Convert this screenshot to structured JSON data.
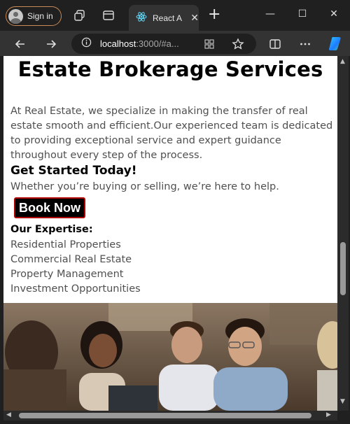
{
  "browser": {
    "signin_label": "Sign in",
    "tab_title": "React A",
    "url_host": "localhost",
    "url_rest": ":3000/#a..."
  },
  "page": {
    "title": "Estate Brokerage Services",
    "intro": "At Real Estate, we specialize in making the transfer of real estate smooth and efficient.Our experienced team is dedicated to providing exceptional service and expert guidance throughout every step of the process.",
    "get_started_heading": "Get Started Today!",
    "get_started_text": "Whether you’re buying or selling, we’re here to help.",
    "book_button": "Book Now",
    "expertise_heading": "Our Expertise:",
    "expertise_items": [
      "Residential Properties",
      "Commercial Real Estate",
      "Property Management",
      "Investment Opportunities"
    ]
  },
  "colors": {
    "accent_border": "#b00000",
    "body_text": "#505050",
    "chrome_bg": "#202020"
  },
  "icons": [
    "user-avatar-icon",
    "workspaces-icon",
    "tab-actions-icon",
    "react-logo-icon",
    "close-icon",
    "plus-icon",
    "minimize-icon",
    "maximize-icon",
    "window-close-icon",
    "back-icon",
    "forward-icon",
    "info-icon",
    "extensions-icon",
    "favorite-star-icon",
    "split-screen-icon",
    "more-icon",
    "copilot-icon"
  ]
}
